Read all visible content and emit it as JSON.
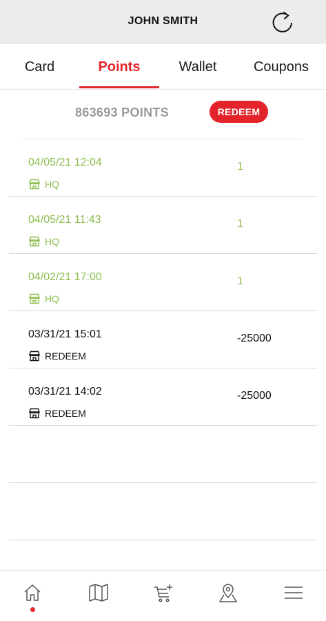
{
  "header": {
    "title": "JOHN SMITH",
    "refresh_icon": "refresh-icon"
  },
  "tabs": [
    {
      "label": "Card"
    },
    {
      "label": "Points"
    },
    {
      "label": "Wallet"
    },
    {
      "label": "Coupons"
    }
  ],
  "active_tab": "Points",
  "points": {
    "summary": "863693 POINTS",
    "redeem_label": "REDEEM"
  },
  "transactions": [
    {
      "date": "04/05/21 12:04",
      "location": "HQ",
      "amount": "1"
    },
    {
      "date": "04/05/21 11:43",
      "location": "HQ",
      "amount": "1"
    },
    {
      "date": "04/02/21 17:00",
      "location": "HQ",
      "amount": "1"
    },
    {
      "date": "03/31/21 15:01",
      "location": "REDEEM",
      "amount": "-25000"
    },
    {
      "date": "03/31/21 14:02",
      "location": "REDEEM",
      "amount": "-25000"
    }
  ],
  "colors": {
    "accent": "#e3242b",
    "earned": "#8cbd4e",
    "header_bg": "#ececec",
    "muted": "#9a9a9a"
  },
  "bottom_nav": [
    {
      "icon": "home-icon",
      "active": true
    },
    {
      "icon": "map-icon"
    },
    {
      "icon": "cart-add-icon"
    },
    {
      "icon": "location-pin-icon"
    },
    {
      "icon": "menu-icon"
    }
  ]
}
